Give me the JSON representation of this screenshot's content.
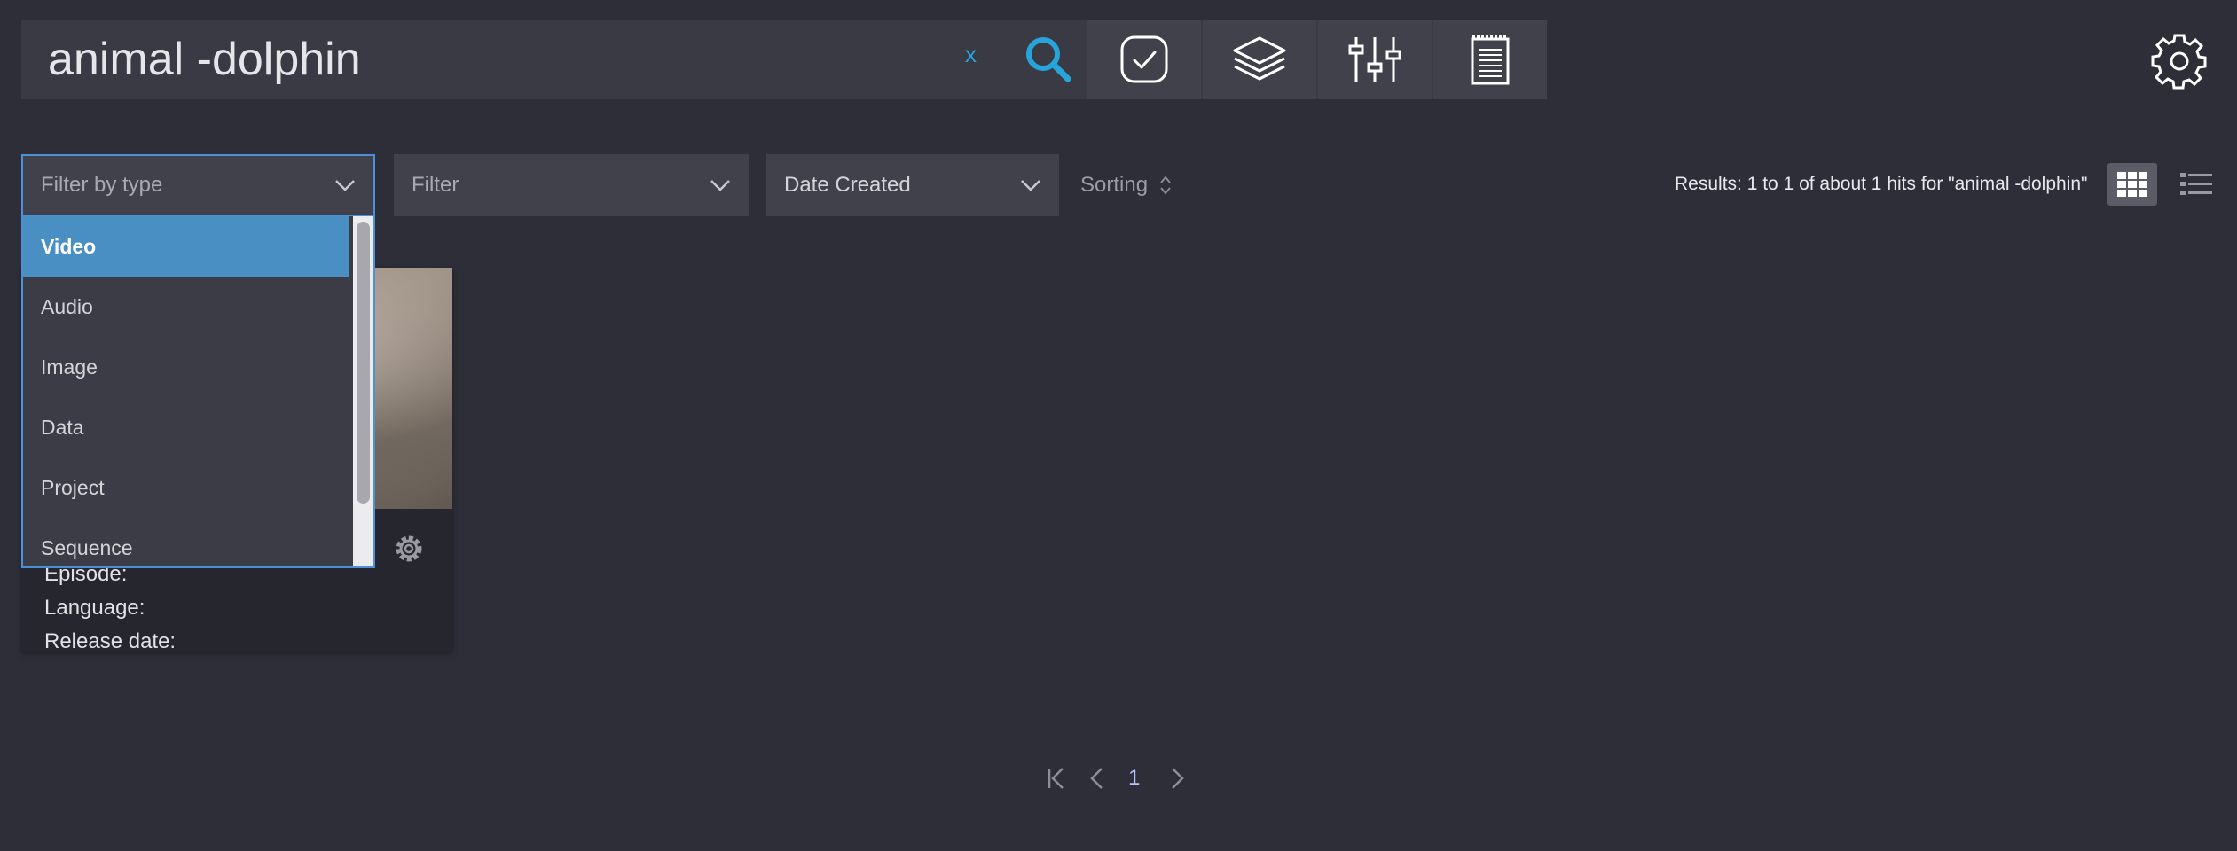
{
  "search": {
    "query": "animal -dolphin",
    "clear_label": "x"
  },
  "toolbar": {
    "icons": [
      "search-icon",
      "check-icon",
      "layers-icon",
      "sliders-icon",
      "notes-icon",
      "gear-icon"
    ]
  },
  "filters": {
    "type_placeholder": "Filter by type",
    "filter_placeholder": "Filter",
    "date_label": "Date Created",
    "sorting_label": "Sorting",
    "type_options": [
      "Video",
      "Audio",
      "Image",
      "Data",
      "Project",
      "Sequence"
    ],
    "selected_option": "Video"
  },
  "results": {
    "summary": "Results: 1 to 1 of about 1 hits for \"animal -dolphin\""
  },
  "card": {
    "meta": [
      "Episode:",
      "Language:",
      "Release date:"
    ]
  },
  "pagination": {
    "current_page": "1"
  },
  "colors": {
    "background": "#2e2e38",
    "accent": "#27a4da",
    "selected_option": "#4a8fc4",
    "focus_border": "#4d8fd9"
  }
}
